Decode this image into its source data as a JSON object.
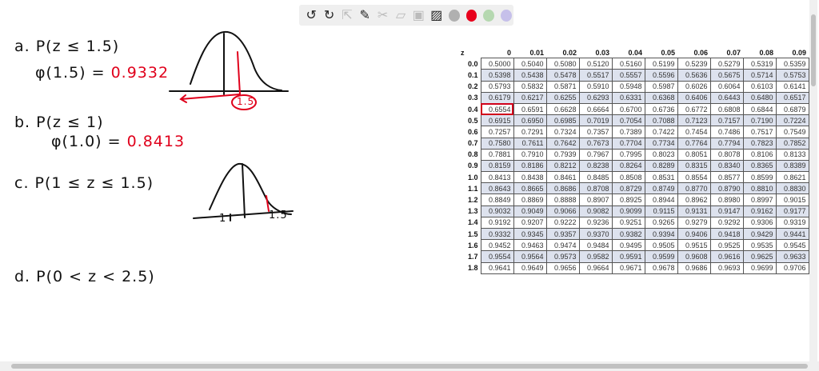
{
  "toolbar": {
    "tools": [
      "undo-icon",
      "redo-icon",
      "select-icon",
      "pen-icon",
      "tools-icon",
      "eraser-icon",
      "text-icon",
      "image-icon"
    ],
    "colors": [
      "#b0b0b0",
      "#e8001c",
      "#b5d8b0",
      "#c6c0ea"
    ]
  },
  "notes": {
    "a_label": "a. P(z ≤ 1.5)",
    "a_phi": "φ(1.5) = ",
    "a_value": "0.9332",
    "a_curve_label": "1.5",
    "b_label": "b. P(z ≤ 1)",
    "b_phi": "φ(1.0) = ",
    "b_value": "0.8413",
    "c_label": "c. P(1 ≤ z ≤ 1.5)",
    "c_curve_left": "1",
    "c_curve_right": "1.5",
    "d_label": "d. P(0 < z < 2.5)"
  },
  "ztable": {
    "corner": "z",
    "columns": [
      "0",
      "0.01",
      "0.02",
      "0.03",
      "0.04",
      "0.05",
      "0.06",
      "0.07",
      "0.08",
      "0.09"
    ],
    "highlighted": {
      "row": "0.4",
      "col": "0"
    },
    "rows": [
      {
        "z": "0.0",
        "v": [
          "0.5000",
          "0.5040",
          "0.5080",
          "0.5120",
          "0.5160",
          "0.5199",
          "0.5239",
          "0.5279",
          "0.5319",
          "0.5359"
        ]
      },
      {
        "z": "0.1",
        "v": [
          "0.5398",
          "0.5438",
          "0.5478",
          "0.5517",
          "0.5557",
          "0.5596",
          "0.5636",
          "0.5675",
          "0.5714",
          "0.5753"
        ]
      },
      {
        "z": "0.2",
        "v": [
          "0.5793",
          "0.5832",
          "0.5871",
          "0.5910",
          "0.5948",
          "0.5987",
          "0.6026",
          "0.6064",
          "0.6103",
          "0.6141"
        ]
      },
      {
        "z": "0.3",
        "v": [
          "0.6179",
          "0.6217",
          "0.6255",
          "0.6293",
          "0.6331",
          "0.6368",
          "0.6406",
          "0.6443",
          "0.6480",
          "0.6517"
        ]
      },
      {
        "z": "0.4",
        "v": [
          "0.6554",
          "0.6591",
          "0.6628",
          "0.6664",
          "0.6700",
          "0.6736",
          "0.6772",
          "0.6808",
          "0.6844",
          "0.6879"
        ]
      },
      {
        "z": "0.5",
        "v": [
          "0.6915",
          "0.6950",
          "0.6985",
          "0.7019",
          "0.7054",
          "0.7088",
          "0.7123",
          "0.7157",
          "0.7190",
          "0.7224"
        ]
      },
      {
        "z": "0.6",
        "v": [
          "0.7257",
          "0.7291",
          "0.7324",
          "0.7357",
          "0.7389",
          "0.7422",
          "0.7454",
          "0.7486",
          "0.7517",
          "0.7549"
        ]
      },
      {
        "z": "0.7",
        "v": [
          "0.7580",
          "0.7611",
          "0.7642",
          "0.7673",
          "0.7704",
          "0.7734",
          "0.7764",
          "0.7794",
          "0.7823",
          "0.7852"
        ]
      },
      {
        "z": "0.8",
        "v": [
          "0.7881",
          "0.7910",
          "0.7939",
          "0.7967",
          "0.7995",
          "0.8023",
          "0.8051",
          "0.8078",
          "0.8106",
          "0.8133"
        ]
      },
      {
        "z": "0.9",
        "v": [
          "0.8159",
          "0.8186",
          "0.8212",
          "0.8238",
          "0.8264",
          "0.8289",
          "0.8315",
          "0.8340",
          "0.8365",
          "0.8389"
        ]
      },
      {
        "z": "1.0",
        "v": [
          "0.8413",
          "0.8438",
          "0.8461",
          "0.8485",
          "0.8508",
          "0.8531",
          "0.8554",
          "0.8577",
          "0.8599",
          "0.8621"
        ]
      },
      {
        "z": "1.1",
        "v": [
          "0.8643",
          "0.8665",
          "0.8686",
          "0.8708",
          "0.8729",
          "0.8749",
          "0.8770",
          "0.8790",
          "0.8810",
          "0.8830"
        ]
      },
      {
        "z": "1.2",
        "v": [
          "0.8849",
          "0.8869",
          "0.8888",
          "0.8907",
          "0.8925",
          "0.8944",
          "0.8962",
          "0.8980",
          "0.8997",
          "0.9015"
        ]
      },
      {
        "z": "1.3",
        "v": [
          "0.9032",
          "0.9049",
          "0.9066",
          "0.9082",
          "0.9099",
          "0.9115",
          "0.9131",
          "0.9147",
          "0.9162",
          "0.9177"
        ]
      },
      {
        "z": "1.4",
        "v": [
          "0.9192",
          "0.9207",
          "0.9222",
          "0.9236",
          "0.9251",
          "0.9265",
          "0.9279",
          "0.9292",
          "0.9306",
          "0.9319"
        ]
      },
      {
        "z": "1.5",
        "v": [
          "0.9332",
          "0.9345",
          "0.9357",
          "0.9370",
          "0.9382",
          "0.9394",
          "0.9406",
          "0.9418",
          "0.9429",
          "0.9441"
        ]
      },
      {
        "z": "1.6",
        "v": [
          "0.9452",
          "0.9463",
          "0.9474",
          "0.9484",
          "0.9495",
          "0.9505",
          "0.9515",
          "0.9525",
          "0.9535",
          "0.9545"
        ]
      },
      {
        "z": "1.7",
        "v": [
          "0.9554",
          "0.9564",
          "0.9573",
          "0.9582",
          "0.9591",
          "0.9599",
          "0.9608",
          "0.9616",
          "0.9625",
          "0.9633"
        ]
      },
      {
        "z": "1.8",
        "v": [
          "0.9641",
          "0.9649",
          "0.9656",
          "0.9664",
          "0.9671",
          "0.9678",
          "0.9686",
          "0.9693",
          "0.9699",
          "0.9706"
        ]
      }
    ]
  }
}
